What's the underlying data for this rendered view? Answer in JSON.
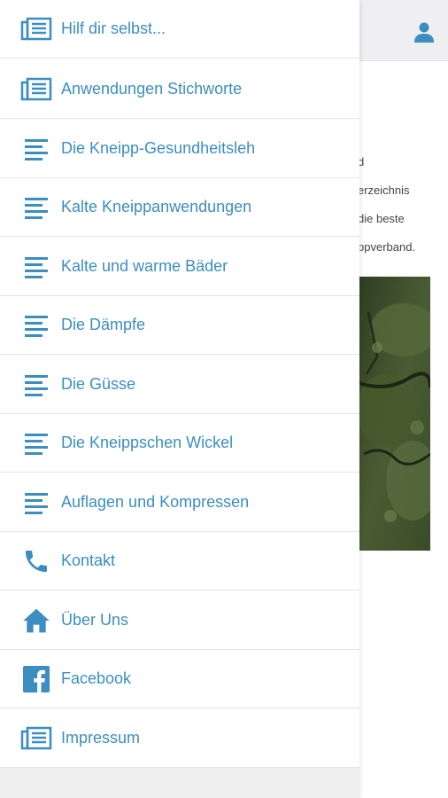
{
  "colors": {
    "accent": "#3b8ebf",
    "divider": "#e4e4e4",
    "header_bg": "#efeff1"
  },
  "header": {
    "user_icon": "user-icon"
  },
  "background_content": {
    "fragments": [
      "d",
      "erzeichnis",
      "die beste",
      "ppverband."
    ],
    "photo": "moss-covered-stone-photo"
  },
  "menu": {
    "items": [
      {
        "label": "Hilf dir selbst...",
        "icon": "newspaper-icon"
      },
      {
        "label": "Anwendungen Stichworte",
        "icon": "newspaper-icon"
      },
      {
        "label": "Die Kneipp-Gesundheitsleh",
        "icon": "text-lines-icon"
      },
      {
        "label": "Kalte Kneippanwendungen",
        "icon": "text-lines-icon"
      },
      {
        "label": "Kalte und warme Bäder",
        "icon": "text-lines-icon"
      },
      {
        "label": "Die Dämpfe",
        "icon": "text-lines-icon"
      },
      {
        "label": "Die Güsse",
        "icon": "text-lines-icon"
      },
      {
        "label": "Die Kneippschen Wickel",
        "icon": "text-lines-icon"
      },
      {
        "label": "Auflagen und Kompressen",
        "icon": "text-lines-icon"
      },
      {
        "label": "Kontakt",
        "icon": "phone-icon"
      },
      {
        "label": "Über Uns",
        "icon": "home-icon"
      },
      {
        "label": "Facebook",
        "icon": "facebook-icon"
      },
      {
        "label": "Impressum",
        "icon": "newspaper-icon"
      }
    ]
  }
}
